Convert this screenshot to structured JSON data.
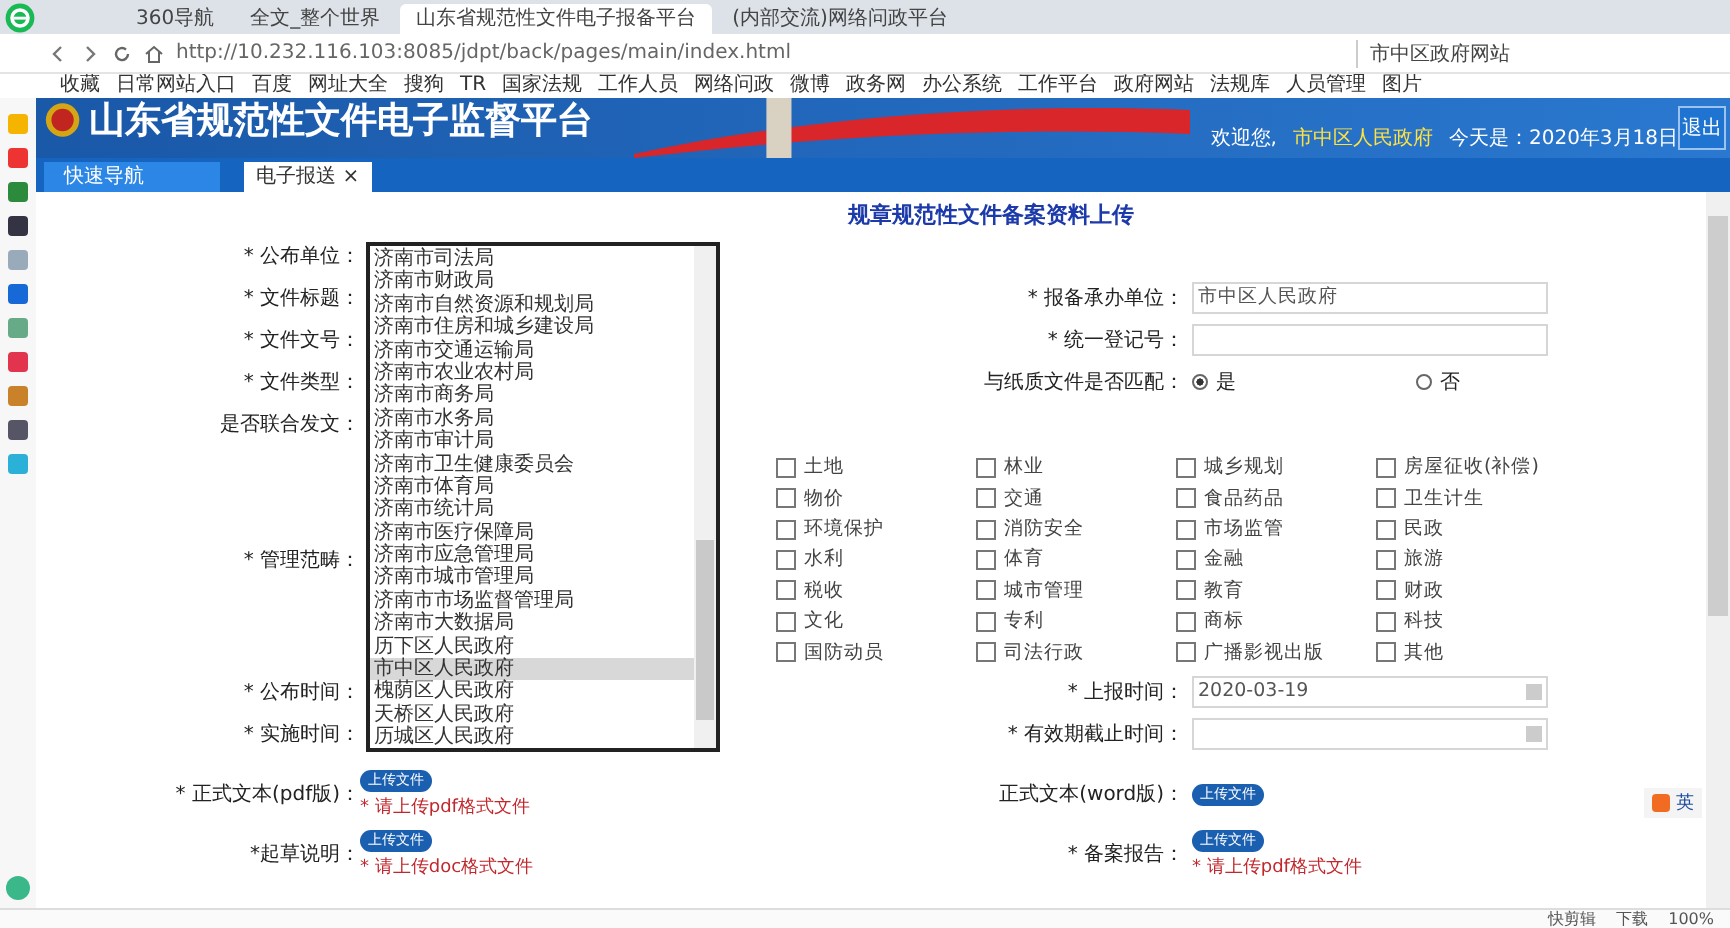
{
  "browser": {
    "tabs": [
      {
        "title": "360导航",
        "selected": false
      },
      {
        "title": "全文_整个世界",
        "selected": false
      },
      {
        "title": "山东省规范性文件电子报备平台",
        "selected": true
      },
      {
        "title": "(内部交流)网络问政平台",
        "selected": false
      }
    ],
    "address": "http://10.232.116.103:8085/jdpt/back/pages/main/index.html",
    "search": "市中区政府网站",
    "bookmarks": [
      "收藏",
      "日常网站入口",
      "百度",
      "网址大全",
      "搜狗",
      "TR",
      "国家法规",
      "工作人员",
      "网络问政",
      "微博",
      "政务网",
      "办公系统",
      "工作平台",
      "政府网站",
      "法规库",
      "人员管理",
      "图片"
    ]
  },
  "header": {
    "title": "山东省规范性文件电子监督平台",
    "welcome": "欢迎您,",
    "unit": "市中区人民政府",
    "date": "今天是：2020年3月18日",
    "logout": "退出"
  },
  "nav": {
    "quick": "快速导航",
    "tabs": [
      {
        "label": "电子报送",
        "close": "×",
        "selected": true
      }
    ]
  },
  "form": {
    "title": "规章规范性文件备案资料上传",
    "top_rows": [
      {
        "left": "* 公布单位："
      },
      {
        "left": "* 文件标题：",
        "right": {
          "kind": "input",
          "label": "* 报备承办单位：",
          "value": "市中区人民政府"
        }
      },
      {
        "left": "* 文件文号：",
        "right": {
          "kind": "input",
          "label": "* 统一登记号："
        }
      },
      {
        "left": "* 文件类型：",
        "right": {
          "kind": "radio",
          "label": "与纸质文件是否匹配：",
          "options": [
            {
              "label": "是",
              "selected": true
            },
            {
              "label": "否",
              "selected": false
            }
          ]
        }
      },
      {
        "left": "是否联合发文："
      }
    ],
    "category_label": "* 管理范畴：",
    "categories": [
      {
        "label": "土地",
        "checked": false
      },
      {
        "label": "林业",
        "checked": false
      },
      {
        "label": "城乡规划",
        "checked": false
      },
      {
        "label": "房屋征收(补偿)",
        "checked": false
      },
      {
        "label": "物价",
        "checked": false
      },
      {
        "label": "交通",
        "checked": false
      },
      {
        "label": "食品药品",
        "checked": false
      },
      {
        "label": "卫生计生",
        "checked": false
      },
      {
        "label": "环境保护",
        "checked": false
      },
      {
        "label": "消防安全",
        "checked": false
      },
      {
        "label": "市场监管",
        "checked": false
      },
      {
        "label": "民政",
        "checked": false
      },
      {
        "label": "水利",
        "checked": false
      },
      {
        "label": "体育",
        "checked": false
      },
      {
        "label": "金融",
        "checked": false
      },
      {
        "label": "旅游",
        "checked": false
      },
      {
        "label": "税收",
        "checked": false
      },
      {
        "label": "城市管理",
        "checked": false
      },
      {
        "label": "教育",
        "checked": false
      },
      {
        "label": "财政",
        "checked": false
      },
      {
        "label": "文化",
        "checked": false
      },
      {
        "label": "专利",
        "checked": false
      },
      {
        "label": "商标",
        "checked": false
      },
      {
        "label": "科技",
        "checked": false
      },
      {
        "label": "国防动员",
        "checked": false
      },
      {
        "label": "司法行政",
        "checked": false
      },
      {
        "label": "广播影视出版",
        "checked": false
      },
      {
        "label": "其他",
        "checked": false
      }
    ],
    "date_rows": [
      {
        "left": "* 公布时间：",
        "right_label": "* 上报时间：",
        "right_value": "2020-03-19"
      },
      {
        "left": "* 实施时间：",
        "right_label": "* 有效期截止时间："
      }
    ],
    "upload_rows": [
      {
        "left": {
          "label": "* 正式文本(pdf版)：",
          "button": "上传文件",
          "hint": "* 请上传pdf格式文件"
        },
        "right": {
          "label": "正式文本(word版)：",
          "button": "上传文件"
        }
      },
      {
        "left": {
          "label": "*起草说明：",
          "button": "上传文件",
          "hint": "* 请上传doc格式文件"
        },
        "right": {
          "label": "* 备案报告：",
          "button": "上传文件",
          "hint": "* 请上传pdf格式文件"
        }
      }
    ],
    "listbox": [
      {
        "label": "济南市司法局",
        "selected": false
      },
      {
        "label": "济南市财政局",
        "selected": false
      },
      {
        "label": "济南市自然资源和规划局",
        "selected": false
      },
      {
        "label": "济南市住房和城乡建设局",
        "selected": false
      },
      {
        "label": "济南市交通运输局",
        "selected": false
      },
      {
        "label": "济南市农业农村局",
        "selected": false
      },
      {
        "label": "济南市商务局",
        "selected": false
      },
      {
        "label": "济南市水务局",
        "selected": false
      },
      {
        "label": "济南市审计局",
        "selected": false
      },
      {
        "label": "济南市卫生健康委员会",
        "selected": false
      },
      {
        "label": "济南市体育局",
        "selected": false
      },
      {
        "label": "济南市统计局",
        "selected": false
      },
      {
        "label": "济南市医疗保障局",
        "selected": false
      },
      {
        "label": "济南市应急管理局",
        "selected": false
      },
      {
        "label": "济南市城市管理局",
        "selected": false
      },
      {
        "label": "济南市市场监督管理局",
        "selected": false
      },
      {
        "label": "济南市大数据局",
        "selected": false
      },
      {
        "label": "历下区人民政府",
        "selected": false
      },
      {
        "label": "市中区人民政府",
        "selected": true
      },
      {
        "label": "槐荫区人民政府",
        "selected": false
      },
      {
        "label": "天桥区人民政府",
        "selected": false
      },
      {
        "label": "历城区人民政府",
        "selected": false
      }
    ]
  },
  "ime": "英",
  "status_bar": [
    "快剪辑",
    "下载",
    "100%"
  ]
}
